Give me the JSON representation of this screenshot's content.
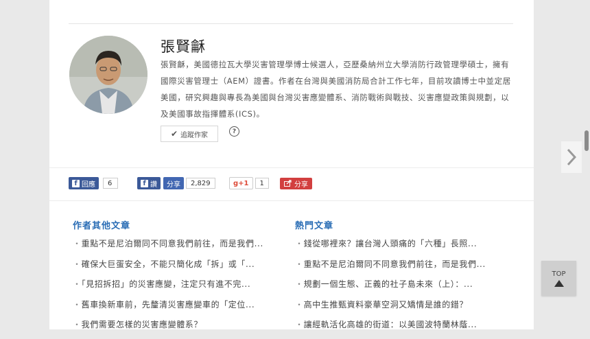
{
  "author": {
    "name": "張賢龢",
    "bio": "張賢龢，美國德拉瓦大學災害管理學博士候選人，亞歷桑納州立大學消防行政管理學碩士，擁有國際災害管理士（AEM）證書。作者在台灣與美國消防局合計工作七年，目前攻讀博士中並定居美國，研究興趣與專長為美國與台灣災害應變體系、消防戰術與戰技、災害應變政策與規劃，以及美國事故指揮體系(ICS)。",
    "follow_label": "追蹤作家",
    "help_icon": "?"
  },
  "share": {
    "fb_like_label": "回應",
    "fb_like_count": "6",
    "fb_share_label": "讚",
    "fb_share_btn": "分享",
    "fb_share_count": "2,829",
    "gplus_label": "+1",
    "gplus_count": "1",
    "share_label": "分享"
  },
  "other_articles": {
    "title": "作者其他文章",
    "items": [
      "重點不是尼泊爾同不同意我們前往，而是我們...",
      "確保大巨蛋安全，不能只簡化成「拆」或「...",
      "「見招拆招」的災害應變，注定只有進不完...",
      "舊車換新車前，先釐清災害應變車的「定位...",
      "我們需要怎樣的災害應變體系？"
    ]
  },
  "hot_articles": {
    "title": "熱門文章",
    "items": [
      "錢從哪裡來？讓台灣人頭痛的「六種」長照...",
      "重點不是尼泊爾同不同意我們前往，而是我們...",
      "規劃一個生態、正義的社子島未來（上）：...",
      "高中生推甄資料豪華空洞又矯情是誰的錯？",
      "讓經軌活化高雄的街道：以美國波特蘭林蔭..."
    ]
  },
  "top_button": {
    "label": "TOP"
  }
}
